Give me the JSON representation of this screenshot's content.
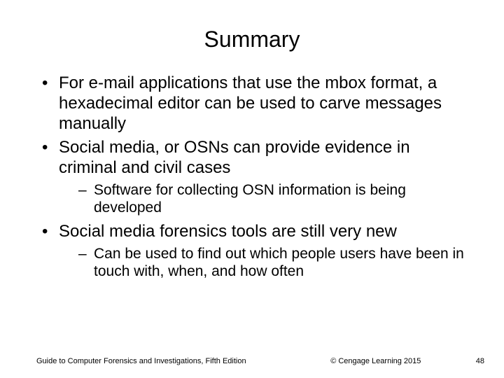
{
  "title": "Summary",
  "bullets": {
    "b0": "For e-mail applications that use the mbox format, a hexadecimal editor can be used to carve messages manually",
    "b1": "Social media, or OSNs can provide evidence in criminal and civil cases",
    "b1_sub0": "Software for collecting OSN information is being developed",
    "b2": "Social media forensics tools are still very new",
    "b2_sub0": "Can be used to find out which people users have been in touch with, when, and how often"
  },
  "footer": {
    "book": "Guide to Computer Forensics and Investigations, Fifth Edition",
    "copyright": "© Cengage Learning  2015",
    "page": "48"
  }
}
